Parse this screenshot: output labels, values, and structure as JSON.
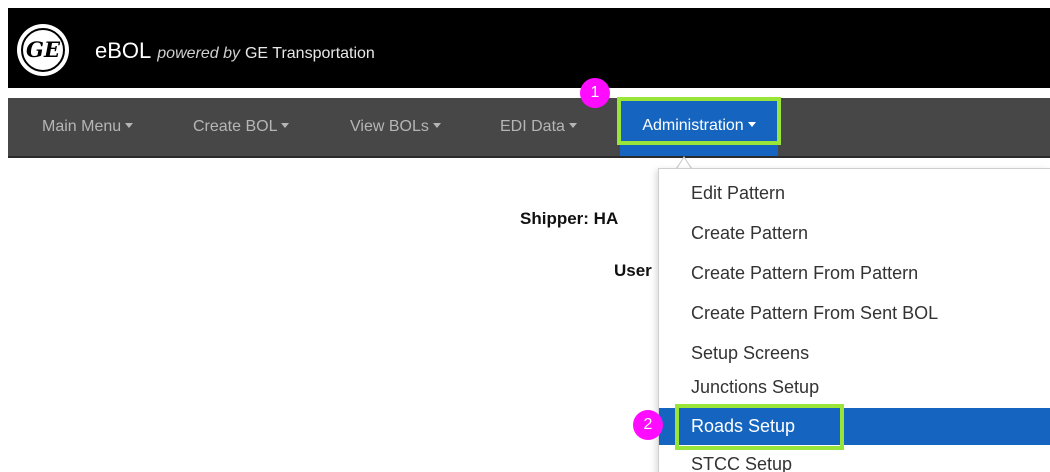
{
  "header": {
    "logo_text": "GE",
    "app_name": "eBOL",
    "powered_by": "powered by",
    "company": "GE Transportation"
  },
  "nav": {
    "items": [
      {
        "label": "Main Menu"
      },
      {
        "label": "Create BOL"
      },
      {
        "label": "View BOLs"
      },
      {
        "label": "EDI Data"
      }
    ],
    "active_label": "Administration"
  },
  "page": {
    "shipper_label": "Shipper: HA",
    "user_label": "User"
  },
  "dropdown": {
    "items": [
      {
        "label": "Edit Pattern"
      },
      {
        "label": "Create Pattern"
      },
      {
        "label": "Create Pattern From Pattern"
      },
      {
        "label": "Create Pattern From Sent BOL"
      },
      {
        "label": "Setup Screens"
      },
      {
        "label": "Junctions Setup"
      },
      {
        "label": "Roads Setup"
      },
      {
        "label": "STCC Setup"
      }
    ],
    "active_index": 6
  },
  "annotations": {
    "step1": "1",
    "step2": "2",
    "highlight_color": "#9ae53a",
    "badge_color": "#ff0bff"
  },
  "colors": {
    "topbar": "#000000",
    "navbar": "#474747",
    "accent": "#1565c0"
  }
}
